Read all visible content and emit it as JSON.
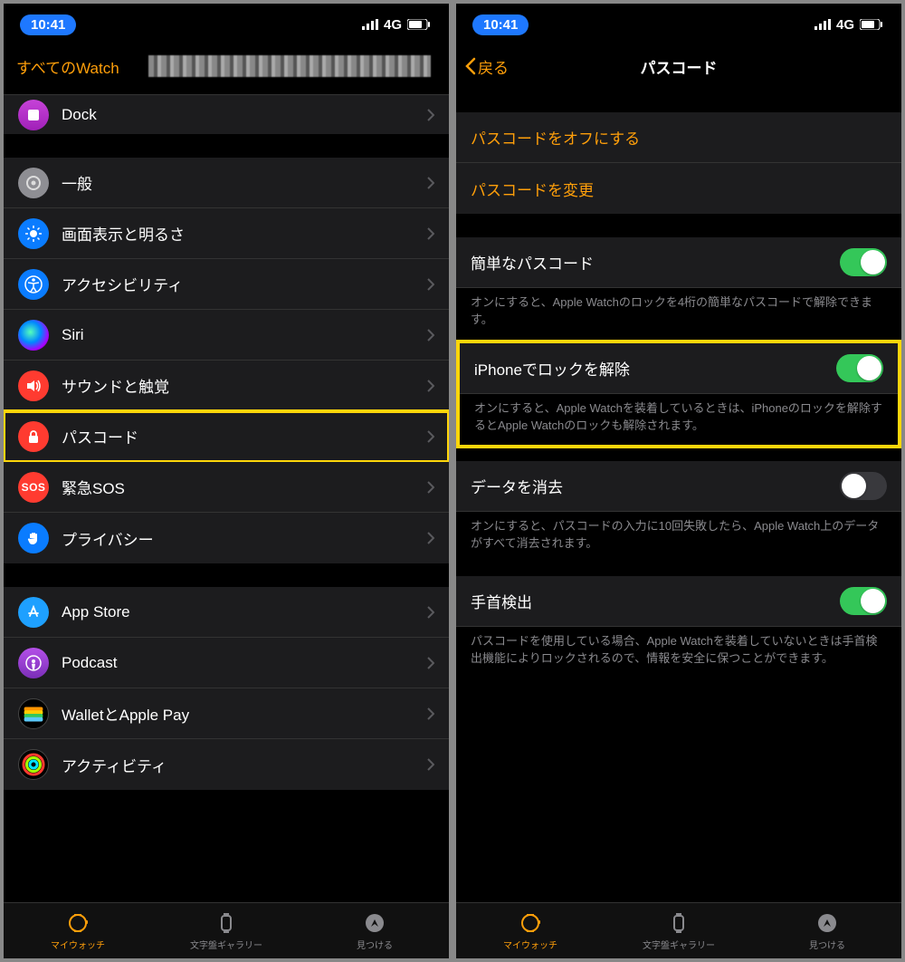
{
  "status": {
    "time": "10:41",
    "network": "4G"
  },
  "left": {
    "backLabel": "すべてのWatch",
    "items": {
      "dock": "Dock",
      "general": "一般",
      "display": "画面表示と明るさ",
      "accessibility": "アクセシビリティ",
      "siri": "Siri",
      "sound": "サウンドと触覚",
      "passcode": "パスコード",
      "sos": "緊急SOS",
      "privacy": "プライバシー",
      "appstore": "App Store",
      "podcast": "Podcast",
      "wallet": "WalletとApple Pay",
      "activity": "アクティビティ",
      "sosShort": "SOS"
    }
  },
  "right": {
    "back": "戻る",
    "title": "パスコード",
    "turnOff": "パスコードをオフにする",
    "change": "パスコードを変更",
    "simple": {
      "label": "簡単なパスコード",
      "footer": "オンにすると、Apple Watchのロックを4桁の簡単なパスコードで解除できます。"
    },
    "unlock": {
      "label": "iPhoneでロックを解除",
      "footer": "オンにすると、Apple Watchを装着しているときは、iPhoneのロックを解除するとApple Watchのロックも解除されます。"
    },
    "erase": {
      "label": "データを消去",
      "footer": "オンにすると、パスコードの入力に10回失敗したら、Apple Watch上のデータがすべて消去されます。"
    },
    "wrist": {
      "label": "手首検出",
      "footer": "パスコードを使用している場合、Apple Watchを装着していないときは手首検出機能によりロックされるので、情報を安全に保つことができます。"
    }
  },
  "tabs": {
    "mywatch": "マイウォッチ",
    "gallery": "文字盤ギャラリー",
    "find": "見つける"
  }
}
